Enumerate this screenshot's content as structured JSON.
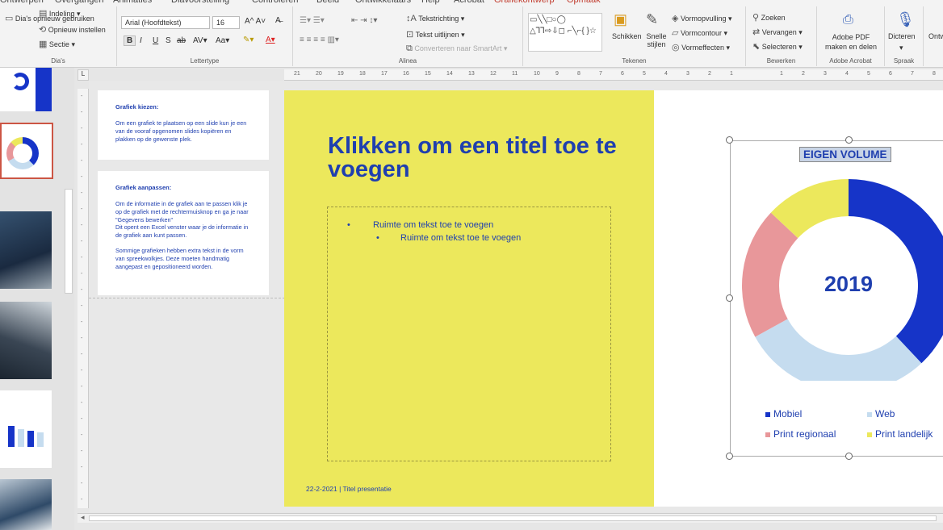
{
  "tabs": [
    "Ontwerpen",
    "Overgangen",
    "Animaties",
    "Diavoorstelling",
    "Controleren",
    "Beeld",
    "Ontwikkelaars",
    "Help",
    "Acrobat",
    "Grafiekontwerp",
    "Opmaak"
  ],
  "ribbon": {
    "dias": {
      "reset": "Opnieuw instellen",
      "reuse": "Dia's opnieuw gebruiken",
      "layout": "Indeling",
      "section": "Sectie",
      "label": "Dia's"
    },
    "font": {
      "name": "Arial (Hoofdtekst)",
      "size": "16",
      "label": "Lettertype"
    },
    "para": {
      "direction": "Tekstrichting",
      "align": "Tekst uitlijnen",
      "smartart": "Converteren naar SmartArt",
      "label": "Alinea"
    },
    "draw": {
      "arrange": "Schikken",
      "quick": "Snelle stijlen",
      "fill": "Vormopvulling",
      "outline": "Vormcontour",
      "effects": "Vormeffecten",
      "label": "Tekenen"
    },
    "edit": {
      "find": "Zoeken",
      "replace": "Vervangen",
      "select": "Selecteren",
      "label": "Bewerken"
    },
    "acrobat": {
      "pdf": "Adobe PDF maken en delen",
      "label": "Adobe Acrobat"
    },
    "speech": {
      "dictate": "Dicteren",
      "label": "Spraak"
    },
    "extra": "Ontw"
  },
  "hruler": [
    "21",
    "20",
    "19",
    "18",
    "17",
    "16",
    "15",
    "14",
    "13",
    "12",
    "11",
    "10",
    "9",
    "8",
    "7",
    "6",
    "5",
    "4",
    "3",
    "2",
    "1"
  ],
  "hruler2": [
    "1",
    "2",
    "3",
    "4",
    "5",
    "6",
    "7",
    "8"
  ],
  "notes": [
    {
      "heading": "Grafiek kiezen:",
      "body": "Om een grafiek te plaatsen op een slide kun je een van de vooraf opgenomen slides kopiëren en plakken op de gewenste plek."
    },
    {
      "heading": "Grafiek aanpassen:",
      "body": "Om de informatie in de grafiek aan te passen klik je op de grafiek met de rechtermuisknop en ga je naar \"Gegevens bewerken\"\nDit opent een Excel venster waar je de informatie in de grafiek aan kunt passen.\n\nSommige grafieken hebben extra tekst in de vorm van spreekwolkjes. Deze moeten handmatig aangepast en gepositioneerd worden."
    }
  ],
  "slide": {
    "title": "Klikken om een titel toe te voegen",
    "bullet1": "Ruimte om tekst toe te voegen",
    "bullet2": "Ruimte om tekst toe te voegen",
    "footer": "22-2-2021 | Titel presentatie"
  },
  "colors": {
    "blue": "#1634c8",
    "lightblue": "#c5dcef",
    "pink": "#e8979a",
    "yellow": "#ece85c"
  },
  "chart_data": {
    "type": "pie",
    "title": "EIGEN VOLUME",
    "center_label": "2019",
    "categories": [
      "Mobiel",
      "Web",
      "Print regionaal",
      "Print landelijk"
    ],
    "values": [
      38,
      29,
      20,
      13
    ]
  }
}
